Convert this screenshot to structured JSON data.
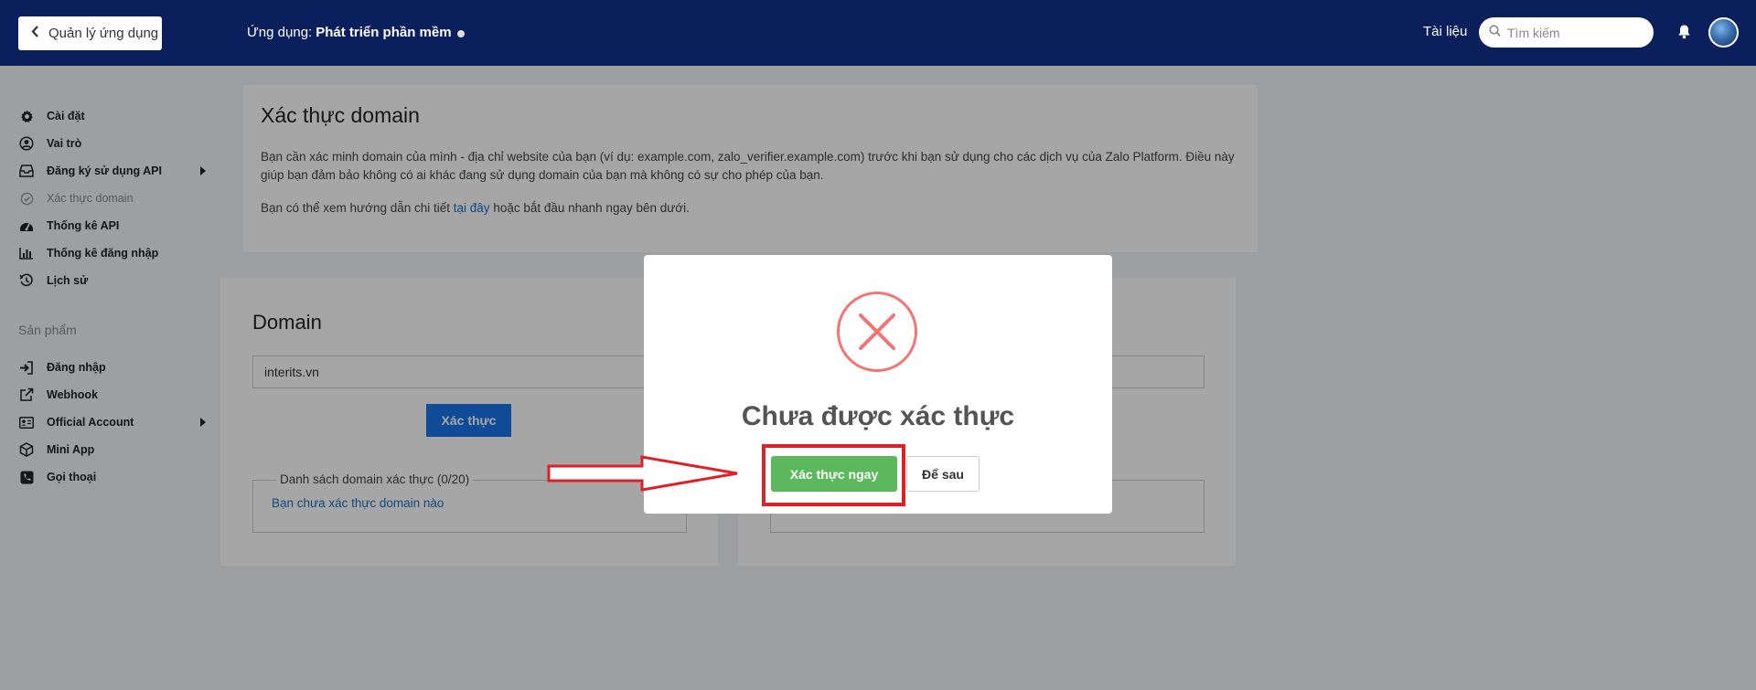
{
  "header": {
    "back_label": "Quản lý ứng dụng",
    "app_prefix": "Ứng dụng:",
    "app_name": "Phát triển phần mềm",
    "docs_label": "Tài liệu",
    "search_placeholder": "Tìm kiếm"
  },
  "sidebar": {
    "items": [
      {
        "label": "Cài đặt",
        "icon": "gear-icon"
      },
      {
        "label": "Vai trò",
        "icon": "user-circle-icon"
      },
      {
        "label": "Đăng ký sử dụng API",
        "icon": "inbox-icon"
      },
      {
        "label": "Xác thực domain",
        "icon": "check-circle-icon"
      },
      {
        "label": "Thống kê API",
        "icon": "gauge-icon"
      },
      {
        "label": "Thống kê đăng nhập",
        "icon": "bar-chart-icon"
      },
      {
        "label": "Lịch sử",
        "icon": "history-icon"
      }
    ],
    "products_title": "Sản phẩm",
    "products": [
      {
        "label": "Đăng nhập",
        "icon": "sign-in-icon"
      },
      {
        "label": "Webhook",
        "icon": "external-link-icon"
      },
      {
        "label": "Official Account",
        "icon": "id-card-icon"
      },
      {
        "label": "Mini App",
        "icon": "cube-icon"
      },
      {
        "label": "Gọi thoại",
        "icon": "phone-icon"
      }
    ]
  },
  "main": {
    "title": "Xác thực domain",
    "desc_line1": "Bạn cần xác minh domain của mình - địa chỉ website của bạn (ví dụ: example.com, zalo_verifier.example.com) trước khi bạn sử dụng cho các dịch vụ của Zalo Platform. Điều này",
    "desc_line2": "giúp bạn đảm bảo không có ai khác đang sử dụng domain của bạn mà không có sự cho phép của bạn.",
    "guide_prefix": "Bạn có thể xem hướng dẫn chi tiết",
    "guide_link": "tại đây",
    "guide_suffix": "hoặc bắt đầu nhanh ngay bên dưới.",
    "domain_heading": "Domain",
    "domain_value": "interits.vn",
    "verify_button": "Xác thực",
    "list_legend": "Danh sách domain xác thực (0/20)",
    "list_empty": "Bạn chưa xác thực domain nào"
  },
  "modal": {
    "title": "Chưa được xác thực",
    "confirm_button": "Xác thực ngay",
    "later_button": "Để sau"
  },
  "colors": {
    "header_bg": "#0a1f5c",
    "primary": "#1a73e8",
    "success": "#5cb85c",
    "error": "#f27474",
    "annotation": "#e01f26"
  }
}
